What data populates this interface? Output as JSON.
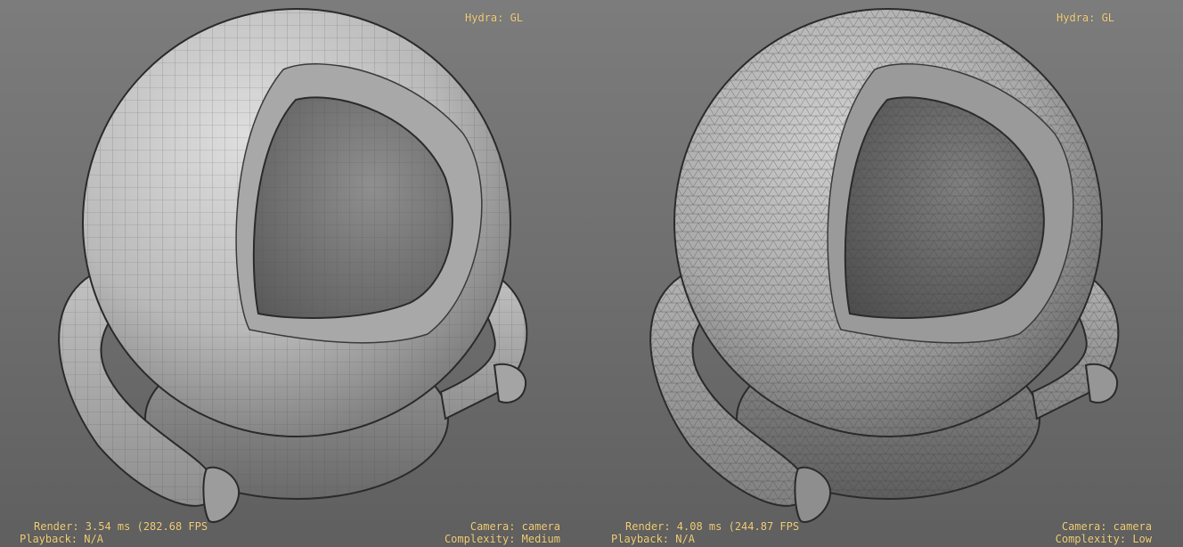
{
  "viewports": [
    {
      "renderer": "Hydra: GL",
      "render_stats": "Render: 3.54 ms (282.68 FPS",
      "playback": "Playback: N/A",
      "camera": "Camera: camera",
      "complexity": "Complexity: Medium",
      "mesh_style": "quad"
    },
    {
      "renderer": "Hydra: GL",
      "render_stats": "Render: 4.08 ms (244.87 FPS",
      "playback": "Playback: N/A",
      "camera": "Camera: camera",
      "complexity": "Complexity: Low",
      "mesh_style": "triangle"
    }
  ],
  "colors": {
    "hud_text": "#f2cf78",
    "background": "#6e6e6e"
  }
}
